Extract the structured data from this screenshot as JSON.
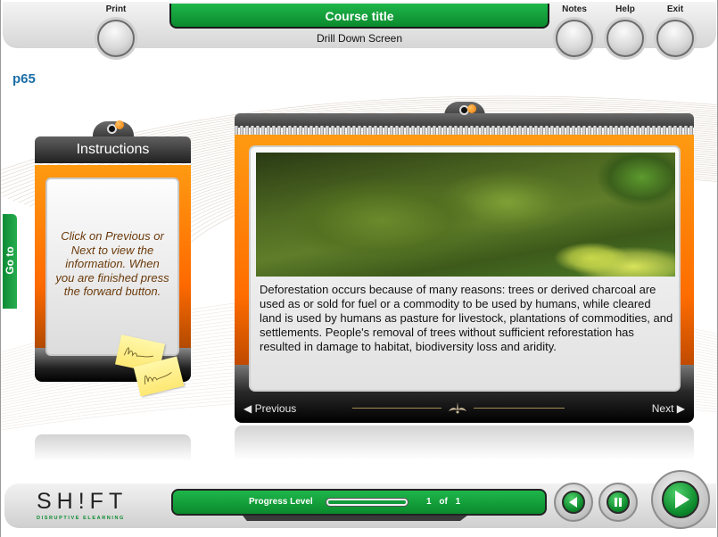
{
  "header": {
    "course_title": "Course title",
    "screen_type": "Drill Down Screen",
    "buttons": [
      {
        "id": "print",
        "label": "Print"
      },
      {
        "id": "notes",
        "label": "Notes"
      },
      {
        "id": "help",
        "label": "Help"
      },
      {
        "id": "exit",
        "label": "Exit"
      }
    ]
  },
  "page_id": "p65",
  "goto_tab": {
    "label": "Go to"
  },
  "instructions": {
    "title": "Instructions",
    "text": "Click on Previous or Next to view the information. When you are finished press the forward button."
  },
  "content": {
    "image_alt": "Dense green shrubs and forest undergrowth with yellow wildflowers",
    "text": "Deforestation occurs because of many reasons: trees or derived charcoal are used as or sold for fuel or a commodity to be used by humans, while cleared land is used by humans as pasture for livestock, plantations of commodities, and settlements. People's removal of trees without sufficient reforestation has resulted in damage to habitat, biodiversity loss and aridity.",
    "nav": {
      "previous": "◀ Previous",
      "next": "Next ▶"
    }
  },
  "footer": {
    "logo": "SH!FT",
    "tagline": "DISRUPTIVE ELEARNING",
    "progress": {
      "label": "Progress Level",
      "current": 1,
      "total": 1,
      "of_label": "of",
      "fraction": 1.0
    },
    "controls": [
      {
        "id": "back",
        "icon": "back-icon"
      },
      {
        "id": "pause",
        "icon": "pause-icon"
      },
      {
        "id": "forward",
        "icon": "play-icon"
      }
    ]
  },
  "colors": {
    "brand_green": "#0a8a2d",
    "accent_orange": "#ff8a00",
    "page_id_blue": "#1b6ea6",
    "instruction_text": "#6b3a0b"
  }
}
